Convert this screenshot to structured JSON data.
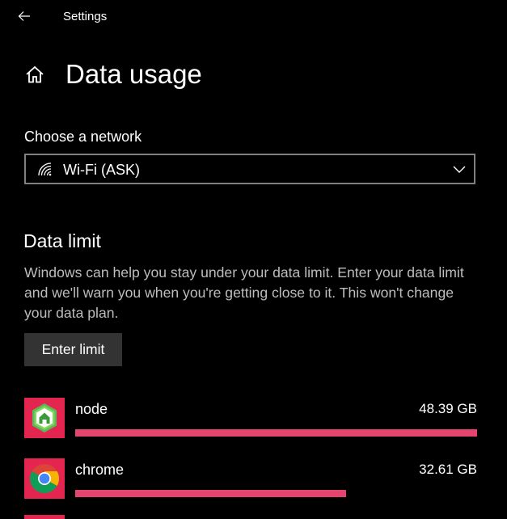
{
  "window": {
    "title": "Settings",
    "back_icon": "back-arrow-icon"
  },
  "page": {
    "title": "Data usage",
    "home_icon": "home-icon"
  },
  "network": {
    "label": "Choose a network",
    "selected": "Wi-Fi (ASK)",
    "icon": "wifi-icon"
  },
  "data_limit": {
    "title": "Data limit",
    "description": "Windows can help you stay under your data limit. Enter your data limit and we'll warn you when you're getting close to it. This won't change your data plan.",
    "button_label": "Enter limit"
  },
  "apps": [
    {
      "name": "node",
      "usage": "48.39 GB",
      "usage_gb": 48.39,
      "icon": "node-app-icon"
    },
    {
      "name": "chrome",
      "usage": "32.61 GB",
      "usage_gb": 32.61,
      "icon": "chrome-icon"
    }
  ],
  "colors": {
    "accent": "#e3254f",
    "bar": "#e3456e",
    "background": "#000000",
    "button": "#333333"
  }
}
